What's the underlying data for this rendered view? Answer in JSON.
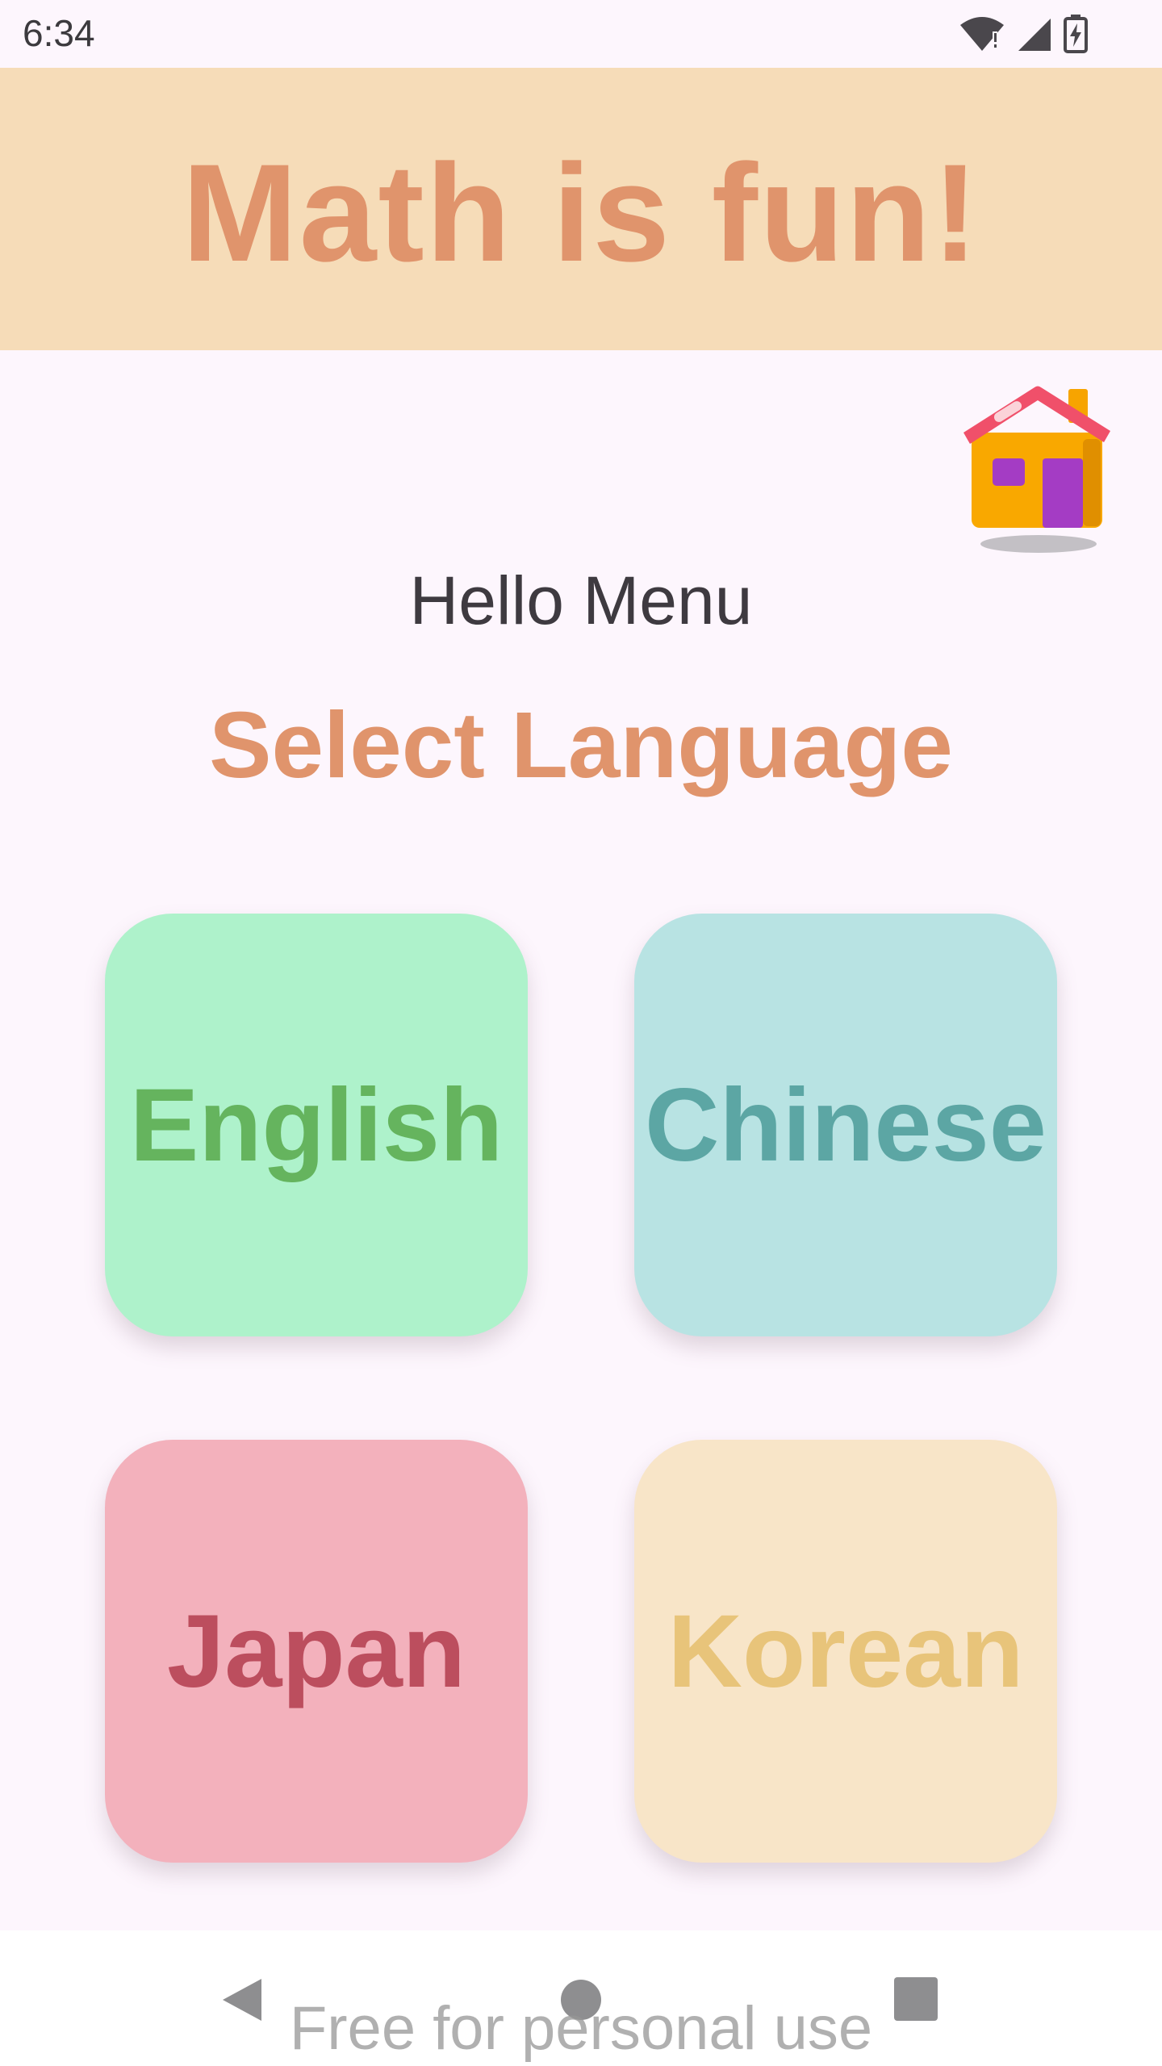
{
  "status_bar": {
    "time": "6:34"
  },
  "header": {
    "title": "Math is fun!",
    "background": "#F6DCB8",
    "title_color": "#E0946C"
  },
  "home_button": {
    "icon": "house-icon"
  },
  "greeting": "Hello Menu",
  "section_title": "Select Language",
  "languages": [
    {
      "label": "English",
      "background": "#AEF2CB",
      "text_color": "#65B45E"
    },
    {
      "label": "Chinese",
      "background": "#B8E3E3",
      "text_color": "#5CA6A4"
    },
    {
      "label": "Japan",
      "background": "#F3B1BC",
      "text_color": "#BC4E5E"
    },
    {
      "label": "Korean",
      "background": "#F8E5C8",
      "text_color": "#E8C47A"
    }
  ],
  "nav_bar": {
    "watermark": "Free for personal use"
  }
}
